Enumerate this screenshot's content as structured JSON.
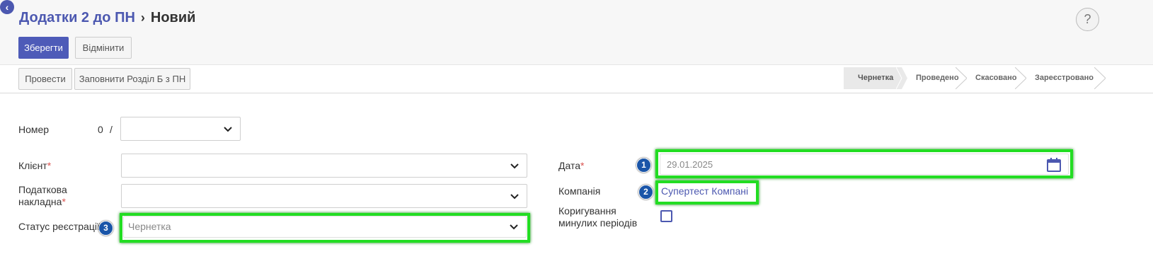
{
  "header": {
    "back_icon": "chevron-left-icon",
    "breadcrumb_parent": "Додатки 2 до ПН",
    "breadcrumb_separator": "›",
    "breadcrumb_current": "Новий",
    "help_label": "?"
  },
  "actions": {
    "save_label": "Зберегти",
    "discard_label": "Відмінити"
  },
  "statusbar": {
    "post_label": "Провести",
    "fill_label": "Заповнити Розділ Б з ПН",
    "stages": [
      "Чернетка",
      "Проведено",
      "Скасовано",
      "Зареєстровано"
    ],
    "active_stage": "Чернетка"
  },
  "form": {
    "number_label": "Номер",
    "number_value": "0",
    "number_separator": "/",
    "number_select_value": "",
    "client_label": "Клієнт",
    "client_value": "",
    "tax_invoice_label_line1": "Податкова",
    "tax_invoice_label_line2": "накладна",
    "tax_invoice_value": "",
    "reg_status_label": "Статус реєстрації",
    "reg_status_value": "Чернетка",
    "date_label": "Дата",
    "date_value": "29.01.2025",
    "company_label": "Компанія",
    "company_value": "Супертест Компані",
    "correction_label_line1": "Коригування",
    "correction_label_line2": "минулих періодів",
    "correction_checked": false,
    "required_mark": "*"
  },
  "annotations": {
    "badge_1": "1",
    "badge_2": "2",
    "badge_3": "3"
  },
  "colors": {
    "accent": "#4c58b0",
    "highlight": "#22dd22",
    "badge": "#1a55a8",
    "required": "#d9534f"
  }
}
